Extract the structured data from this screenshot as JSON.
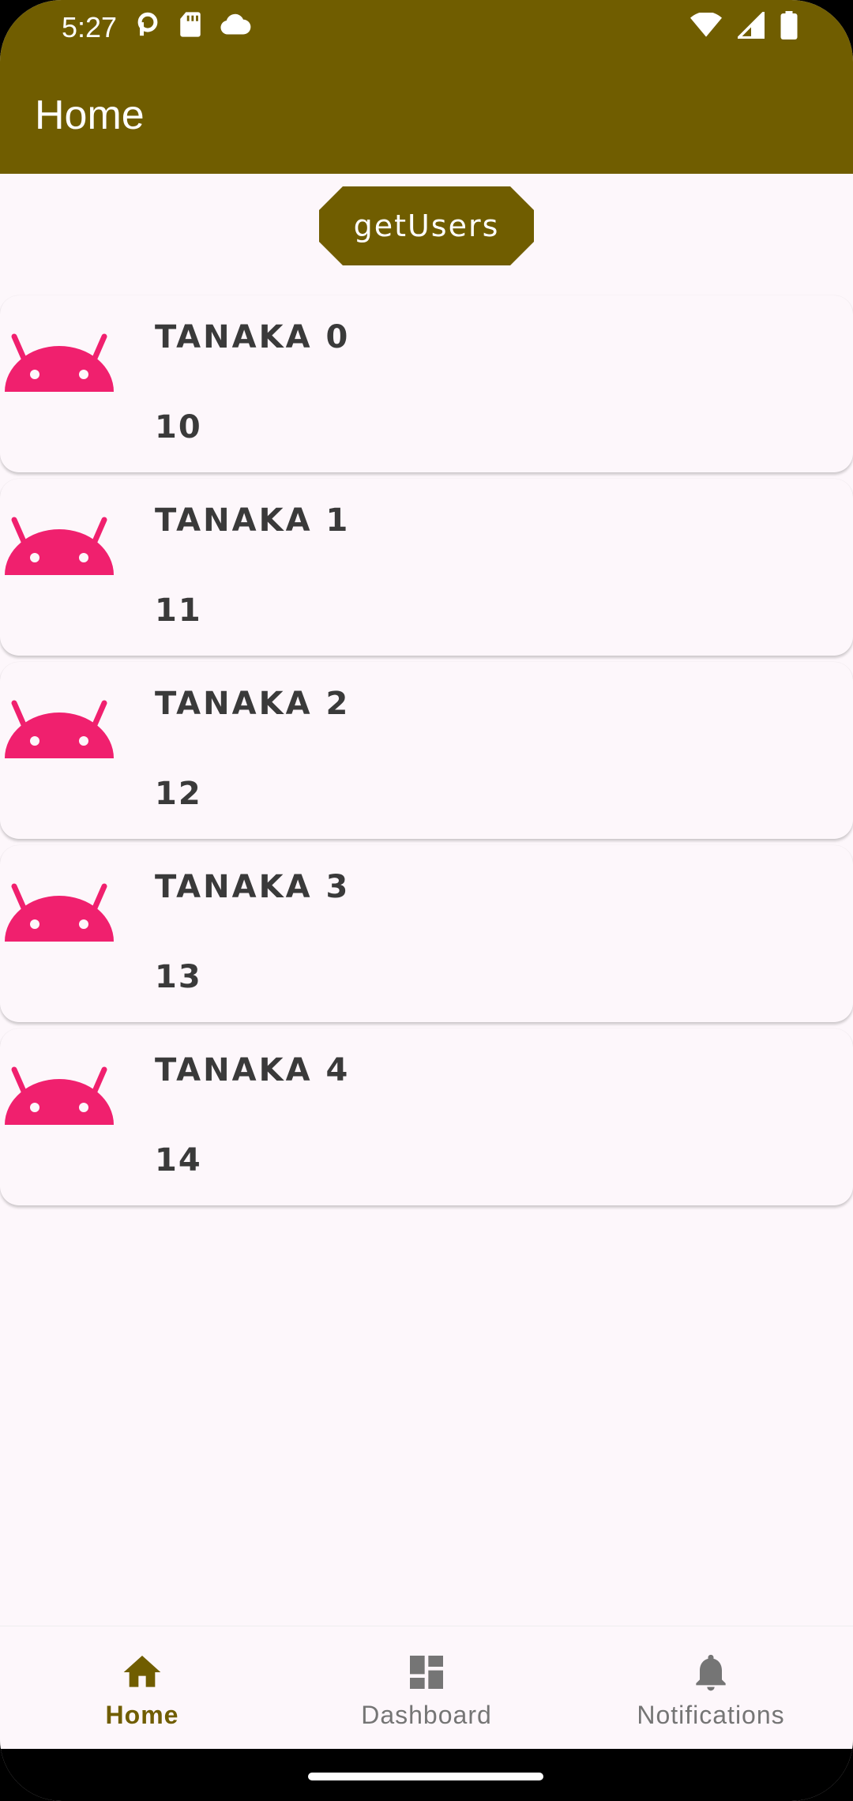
{
  "status_bar": {
    "time": "5:27",
    "left_icons": [
      "p-icon",
      "sd-card-icon",
      "cloud-icon"
    ],
    "right_icons": [
      "wifi-icon",
      "signal-icon",
      "battery-icon"
    ]
  },
  "app_bar": {
    "title": "Home"
  },
  "actions": {
    "get_users_label": "getUsers"
  },
  "users": [
    {
      "name": "Tanaka 0",
      "age": "10"
    },
    {
      "name": "Tanaka 1",
      "age": "11"
    },
    {
      "name": "Tanaka 2",
      "age": "12"
    },
    {
      "name": "Tanaka 3",
      "age": "13"
    },
    {
      "name": "Tanaka 4",
      "age": "14"
    }
  ],
  "bottom_nav": {
    "items": [
      {
        "label": "Home",
        "icon": "home-icon",
        "active": true
      },
      {
        "label": "Dashboard",
        "icon": "dashboard-icon",
        "active": false
      },
      {
        "label": "Notifications",
        "icon": "bell-icon",
        "active": false
      }
    ]
  },
  "colors": {
    "primary": "#705d00",
    "background": "#fdf7fb",
    "android_icon": "#f0206e",
    "text_dark": "#3a3a3a",
    "nav_inactive": "#757575"
  }
}
